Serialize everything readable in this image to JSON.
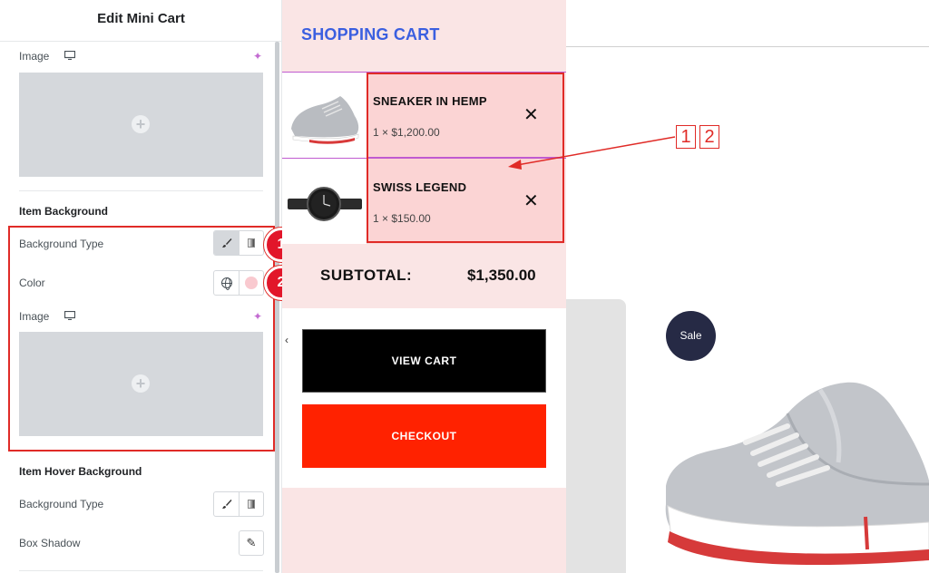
{
  "editor": {
    "title": "Edit Mini Cart",
    "image_label": "Image",
    "item_background_heading": "Item Background",
    "background_type_label": "Background Type",
    "color_label": "Color",
    "image_label_2": "Image",
    "item_hover_background_heading": "Item Hover Background",
    "hover_background_type_label": "Background Type",
    "box_shadow_label": "Box Shadow",
    "color_swatch": "#f9c9cf"
  },
  "callouts": {
    "badge_1": "1",
    "badge_2": "2"
  },
  "cart": {
    "title": "SHOPPING CART",
    "items": [
      {
        "name": "SNEAKER IN HEMP",
        "price": "1 × $1,200.00"
      },
      {
        "name": "SWISS LEGEND",
        "price": "1 × $150.00"
      }
    ],
    "remove_glyph": "✕",
    "subtotal_label": "SUBTOTAL:",
    "subtotal_value": "$1,350.00",
    "view_cart_label": "VIEW CART",
    "checkout_label": "CHECKOUT",
    "collapse_glyph": "‹",
    "title_color": "#3b5fe0",
    "checkout_color": "#ff2200"
  },
  "annotation": {
    "label_1": "1",
    "label_2": "2"
  },
  "product": {
    "sale_label": "Sale"
  },
  "icons": {
    "plus": "+",
    "sparkle": "✦",
    "brush": "🖌",
    "pencil": "✎"
  }
}
